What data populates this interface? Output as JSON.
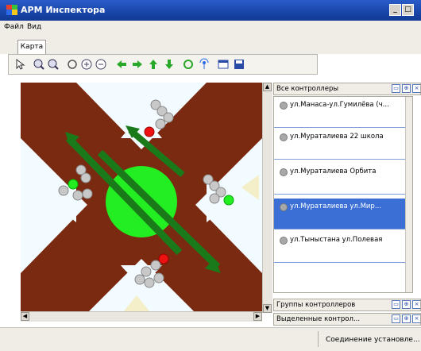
{
  "window": {
    "title": "АРМ Инспектора"
  },
  "menu": {
    "file": "Файл",
    "view": "Вид"
  },
  "tabs": [
    {
      "label": "Карта"
    }
  ],
  "toolbar": {
    "icons": [
      "cursor-icon",
      "zoom-in-icon",
      "zoom-out-icon",
      "rotate-icon",
      "zoom-plus-icon",
      "zoom-minus-icon",
      "arrow-left-icon",
      "arrow-right-icon",
      "arrow-up-icon",
      "arrow-down-icon",
      "refresh-icon",
      "antenna-icon",
      "window-icon",
      "save-icon"
    ]
  },
  "controllers_panel": {
    "title": "Все контроллеры",
    "items": [
      {
        "label": "ул.Манаса-ул.Гумилёва (ч...",
        "selected": false
      },
      {
        "label": "ул.Мураталиева 22 школа",
        "selected": false
      },
      {
        "label": "ул.Мураталиева Орбита",
        "selected": false
      },
      {
        "label": "ул.Мураталиева ул.Мир...",
        "selected": true
      },
      {
        "label": "ул.Тыныстана ул.Полевая",
        "selected": false
      }
    ]
  },
  "groups_panel": {
    "title": "Группы контроллеров"
  },
  "selected_panel": {
    "title": "Выделенные контрол..."
  },
  "status": {
    "text": "Соединение установле..."
  },
  "colors": {
    "road": "#7a2a10",
    "intersection": "#22ee22",
    "arrow": "#1a7a1a",
    "selection": "#3b6fd6",
    "title_bar": "#1845a8"
  }
}
